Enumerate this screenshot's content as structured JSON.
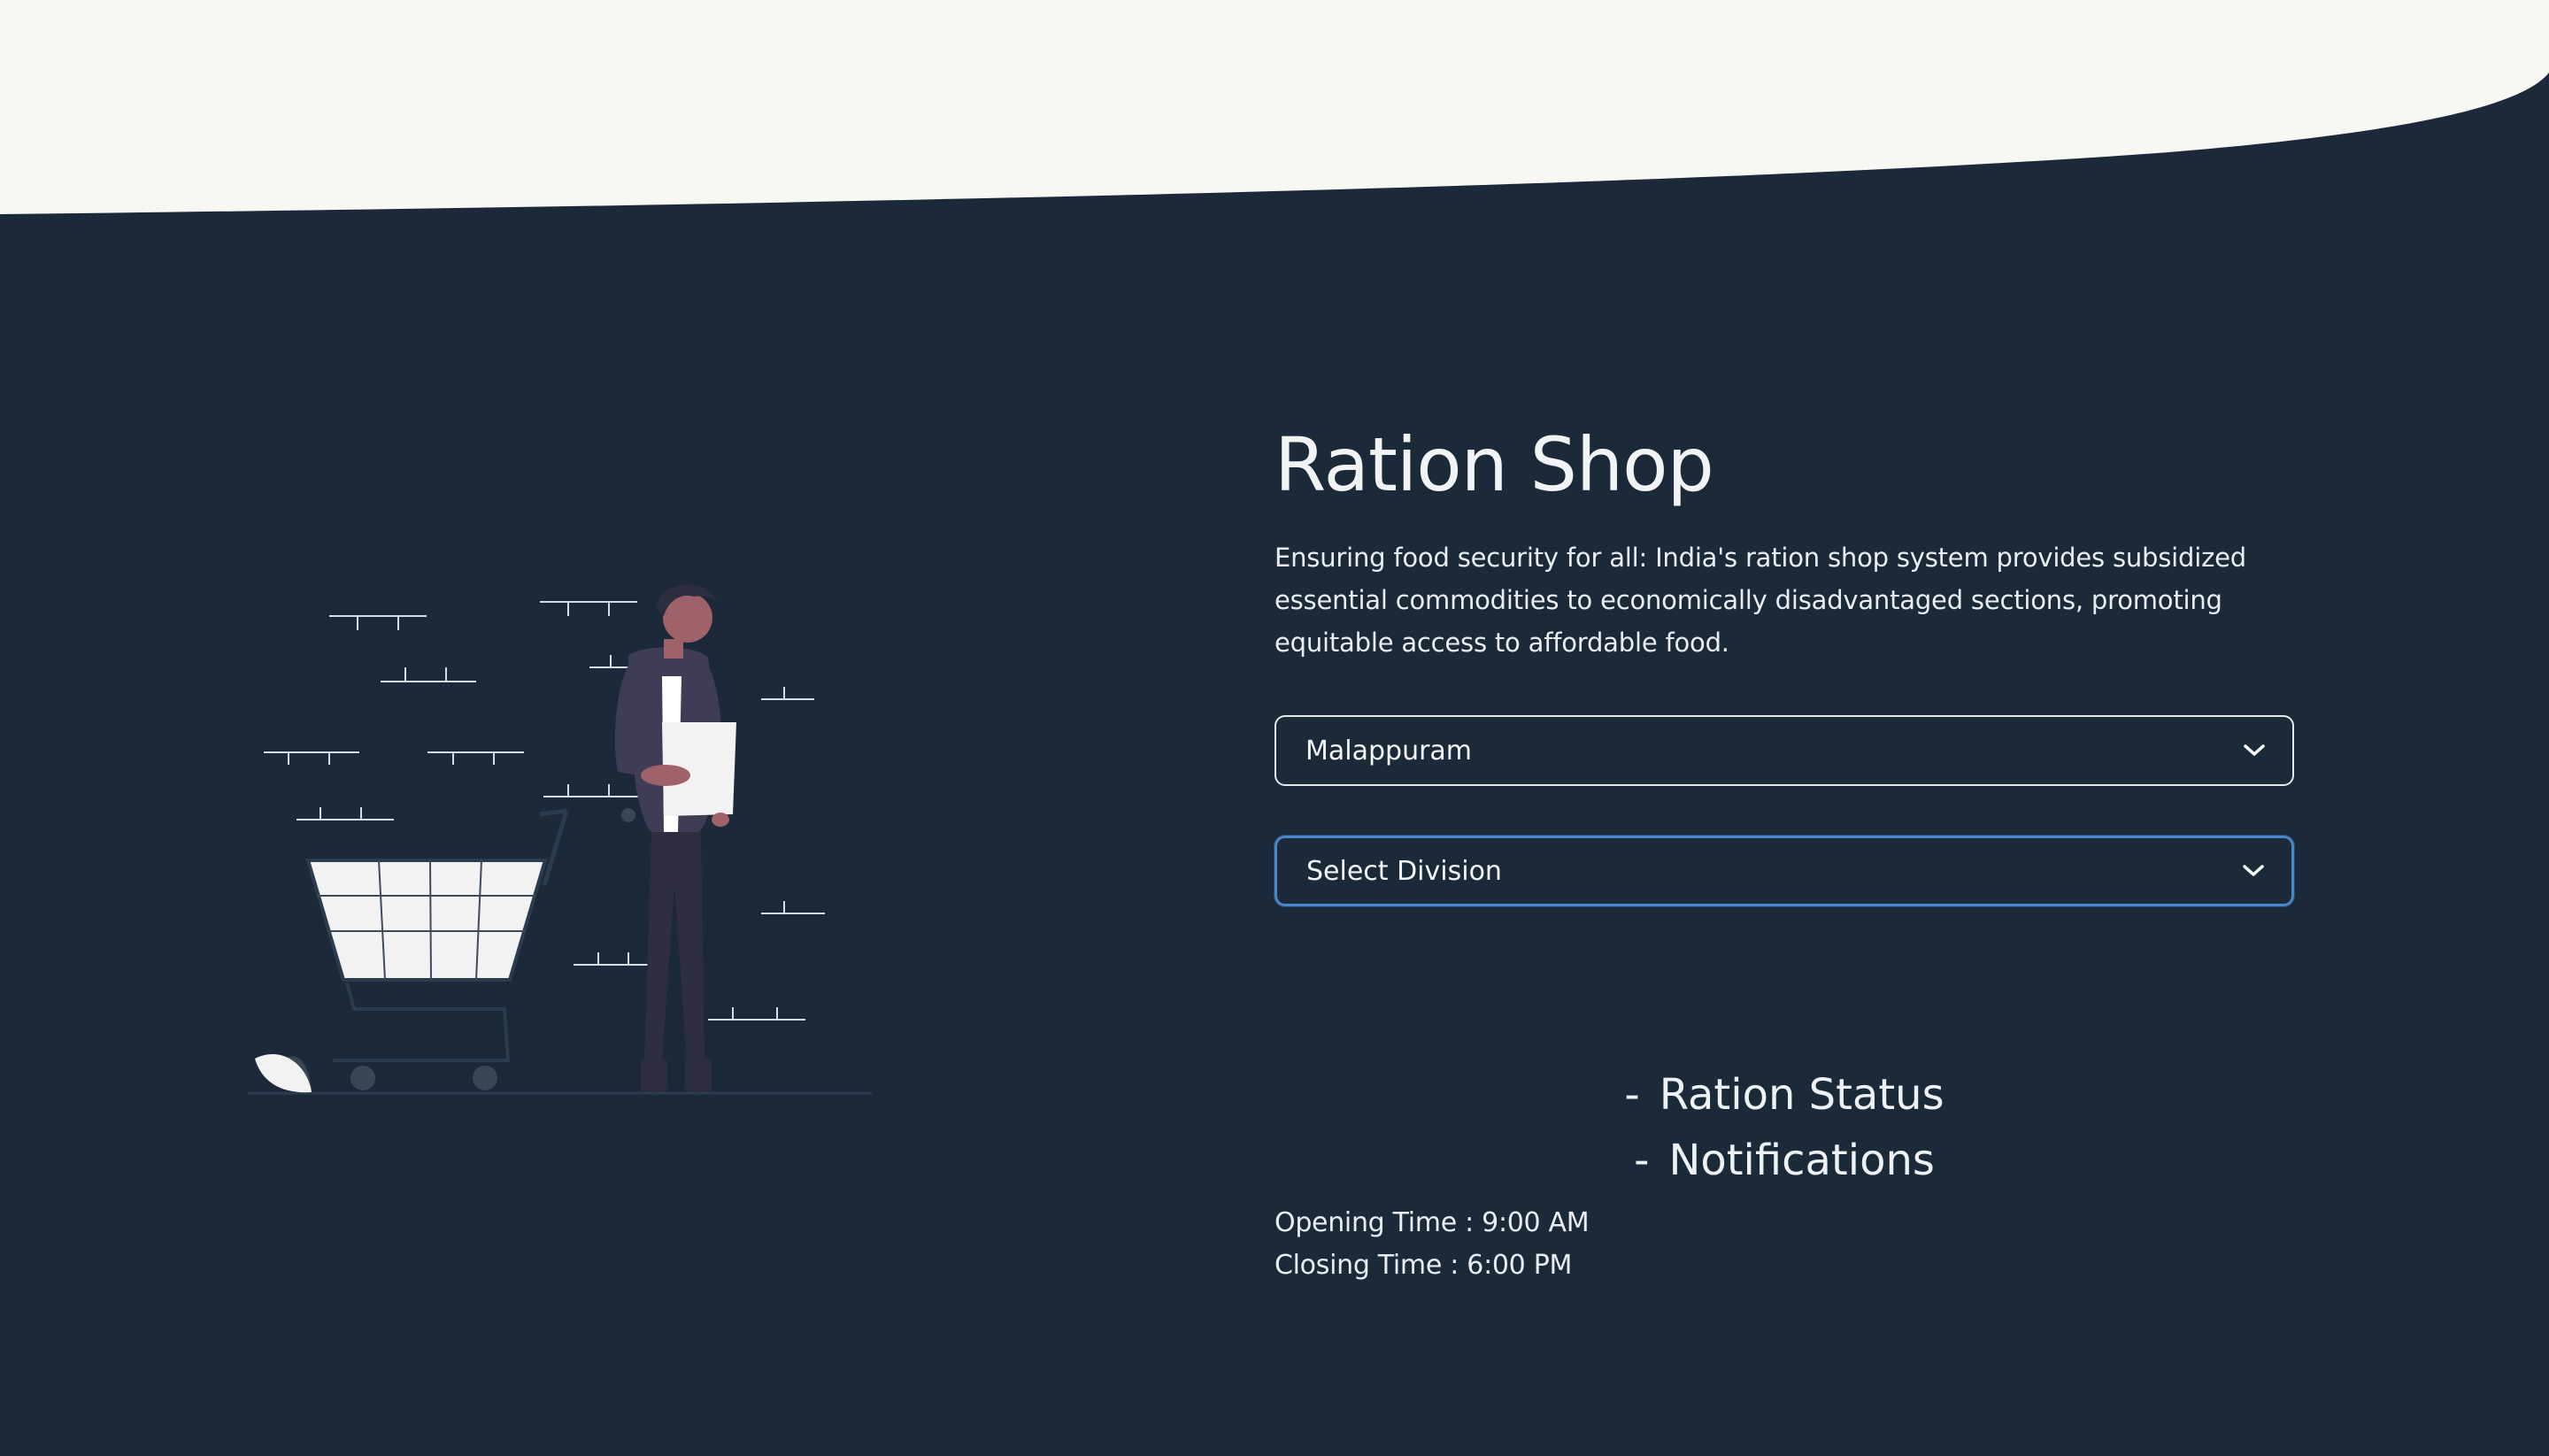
{
  "page": {
    "background_color": "#1b2939",
    "header_wave_color": "#f7f7f3",
    "focus_color": "#4a86c9"
  },
  "hero": {
    "title": "Ration Shop",
    "description": "Ensuring food security for all: India's ration shop system provides subsidized essential commodities to economically disadvantaged sections, promoting equitable access to affordable food."
  },
  "filters": {
    "district": {
      "selected": "Malappuram",
      "icon": "chevron-down-icon"
    },
    "division": {
      "selected": "Select Division",
      "icon": "chevron-down-icon"
    }
  },
  "links": [
    {
      "dash": "-",
      "label": "Ration Status"
    },
    {
      "dash": "-",
      "label": "Notifications"
    }
  ],
  "timings": {
    "opening": "Opening Time : 9:00 AM",
    "closing": "Closing Time : 6:00 PM"
  },
  "illustration": {
    "icon": "shopping-cart-person-illustration"
  }
}
